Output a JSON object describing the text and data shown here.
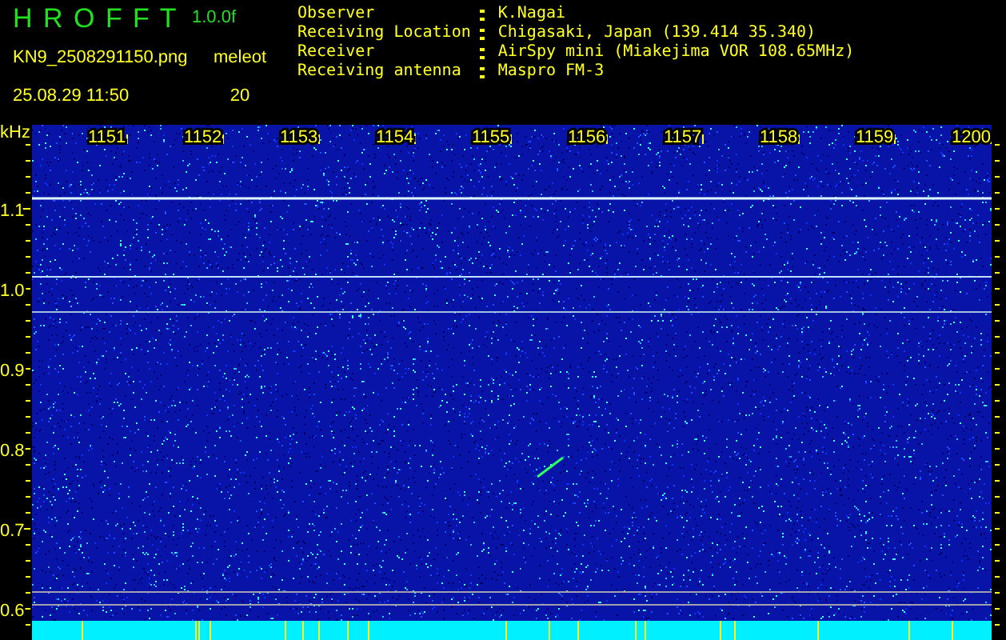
{
  "header": {
    "app_name": "H R O F F T",
    "version": "1.0.0f",
    "file_name": "KN9_2508291150.png",
    "timestamp": "25.08.29 11:50",
    "count_label": "meleot",
    "count": "20",
    "info": [
      {
        "label": "Observer",
        "value": "K.Nagai"
      },
      {
        "label": "Receiving Location",
        "value": "Chigasaki, Japan (139.414 35.340)"
      },
      {
        "label": "Receiver",
        "value": "AirSpy mini (Miakejima VOR 108.65MHz)"
      },
      {
        "label": "Receiving antenna",
        "value": "Maspro FM-3"
      }
    ]
  },
  "spectrogram": {
    "unit": "kHz",
    "time_labels": [
      "1151",
      "1152",
      "1153",
      "1154",
      "1155",
      "1156",
      "1157",
      "1158",
      "1159",
      "1200"
    ],
    "frequency_labels": [
      "1.1",
      "1.0",
      "0.9",
      "0.8",
      "0.7",
      "0.6"
    ]
  }
}
